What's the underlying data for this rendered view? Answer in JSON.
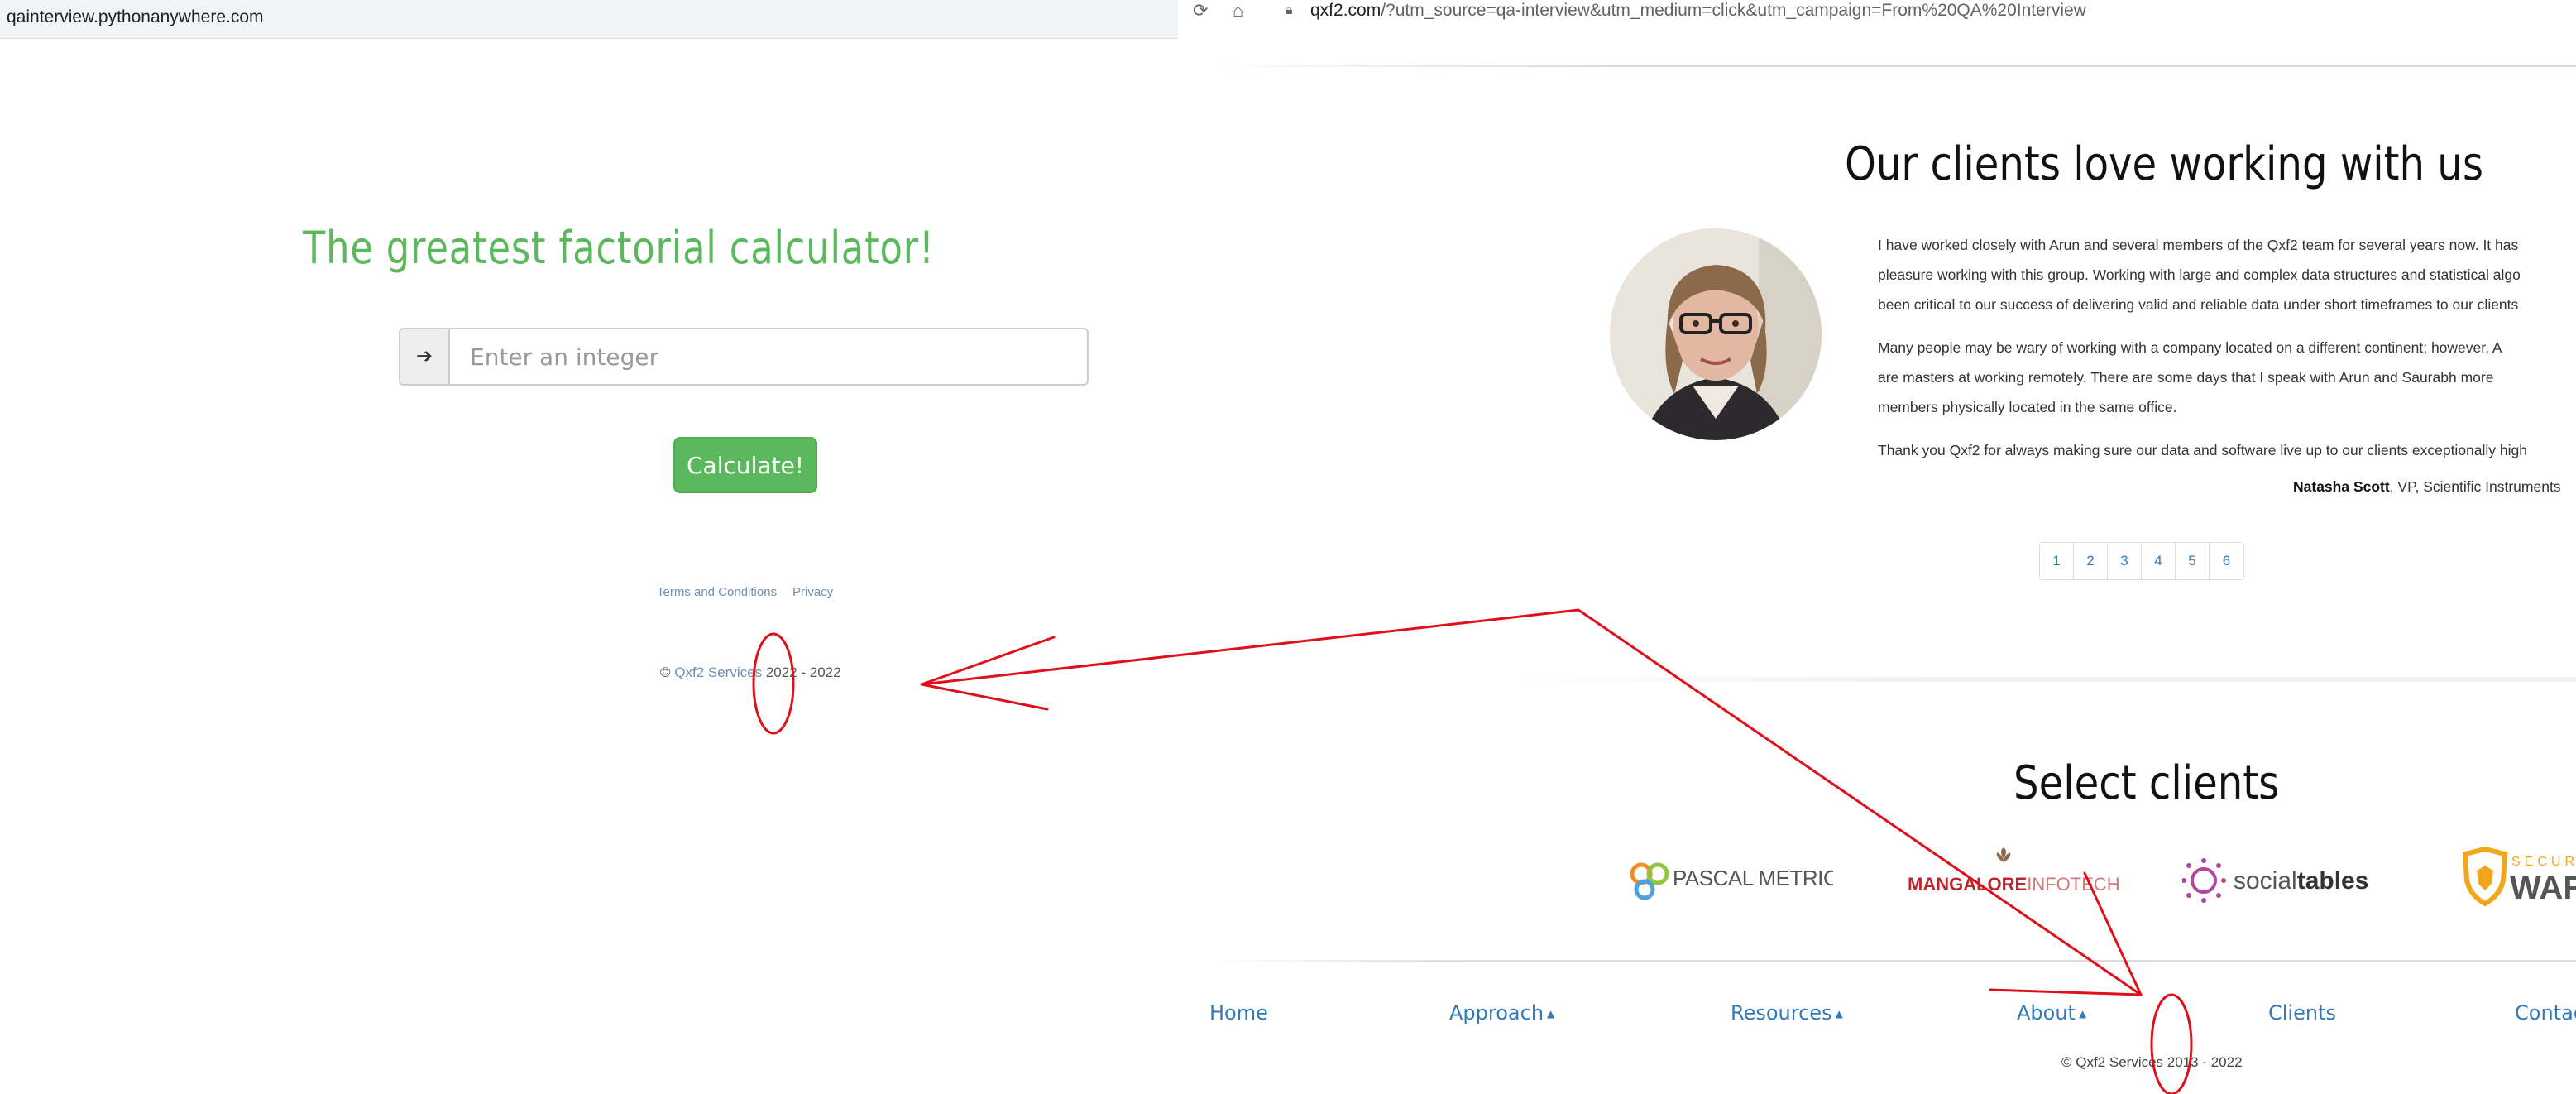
{
  "left": {
    "url": "qainterview.pythonanywhere.com",
    "title": "The greatest factorial calculator!",
    "input": {
      "placeholder": "Enter an integer",
      "icon": "arrow-right-icon"
    },
    "calculate_label": "Calculate!",
    "links": {
      "terms": "Terms and Conditions",
      "privacy": "Privacy"
    },
    "copyright": {
      "symbol": "©",
      "company": "Qxf2 Services",
      "years": "2022 - 2022"
    }
  },
  "right": {
    "url": {
      "host": "qxf2.com",
      "path": "/?utm_source=qa-interview&utm_medium=click&utm_campaign=From%20QA%20Interview"
    },
    "testimonials_heading": "Our clients love working with us",
    "quote": {
      "lines": [
        "I have worked closely with Arun and several members of the Qxf2 team for several years now. It has",
        "pleasure working with this group. Working with large and complex data structures and statistical algo",
        "been critical to our success of delivering valid and reliable data under short timeframes to our clients",
        "Many people may be wary of working with a company located on a different continent; however, A",
        "are masters at working remotely. There are some days that I speak with Arun and Saurabh more",
        "members physically located in the same office.",
        "Thank you Qxf2 for always making sure our data and software live up to our clients exceptionally high"
      ],
      "author": "Natasha Scott",
      "role": ", VP, Scientific Instruments"
    },
    "pagination": [
      "1",
      "2",
      "3",
      "4",
      "5",
      "6"
    ],
    "clients_heading": "Select clients",
    "logos": {
      "pascal": "PASCAL METRICS",
      "mangalore_a": "MANGALORE",
      "mangalore_b": "INFOTECH",
      "socialtables_a": "social",
      "socialtables_b": "tables",
      "secure_a": "SECUR",
      "secure_b": "WAR"
    },
    "nav": {
      "home": "Home",
      "approach": "Approach",
      "resources": "Resources",
      "about": "About",
      "clients": "Clients",
      "contact": "Contac"
    },
    "copyright": "© Qxf2 Services 2013 - 2022"
  },
  "colors": {
    "green": "#5cb85c",
    "link_blue": "#337ab7",
    "annotation_red": "#e0101a"
  }
}
